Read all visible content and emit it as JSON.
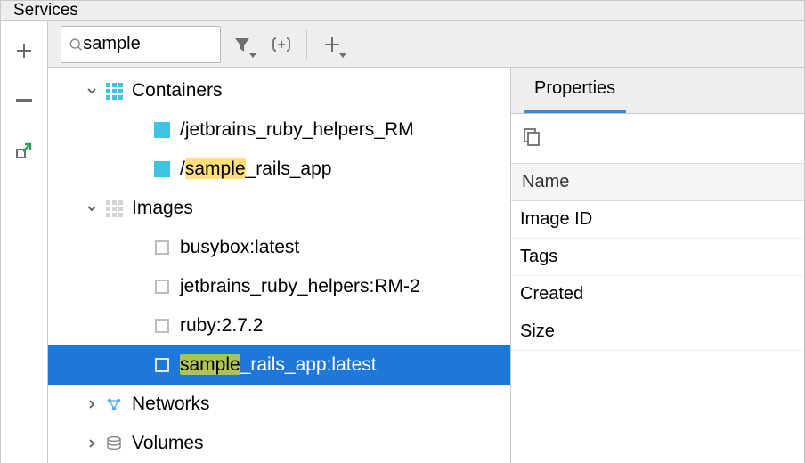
{
  "title": "Services",
  "search": {
    "value": "sample"
  },
  "tree": {
    "containers_label": "Containers",
    "images_label": "Images",
    "networks_label": "Networks",
    "volumes_label": "Volumes",
    "container_items": [
      {
        "pre": "/jetbrains_ruby_helpers_RM"
      },
      {
        "pre": "/",
        "hl": "sample",
        "post": "_rails_app"
      }
    ],
    "image_items": [
      {
        "pre": "busybox:latest"
      },
      {
        "pre": "jetbrains_ruby_helpers:RM-2"
      },
      {
        "pre": "ruby:2.7.2"
      },
      {
        "hl": "sample",
        "post": "_rails_app:latest",
        "selected": true
      }
    ]
  },
  "properties": {
    "tab_label": "Properties",
    "header": "Name",
    "rows": [
      "Image ID",
      "Tags",
      "Created",
      "Size"
    ]
  }
}
